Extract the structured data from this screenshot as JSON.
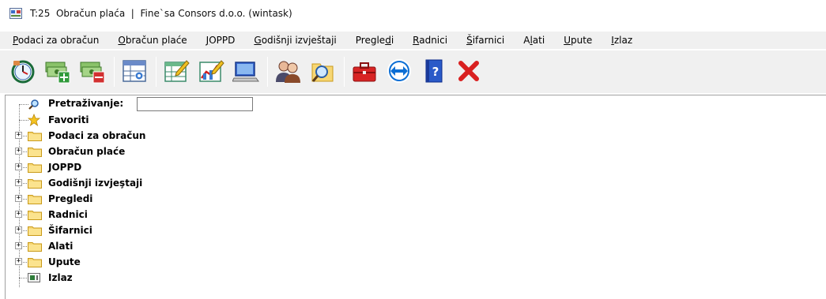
{
  "window": {
    "title": "T:25  Obračun plaća  |  Fine`sa Consors d.o.o. (wintask)"
  },
  "menu": [
    {
      "label": "Podaci za obračun",
      "accel": "P",
      "pre": "",
      "post": "odaci za obračun"
    },
    {
      "label": "Obračun plaće",
      "accel": "O",
      "pre": "",
      "post": "bračun plaće"
    },
    {
      "label": "JOPPD",
      "accel": "J",
      "pre": "",
      "post": "OPPD"
    },
    {
      "label": "Godišnji izvještaji",
      "accel": "G",
      "pre": "",
      "post": "odišnji izvještaji"
    },
    {
      "label": "Pregledi",
      "accel": "d",
      "pre": "Pregle",
      "post": "i"
    },
    {
      "label": "Radnici",
      "accel": "R",
      "pre": "",
      "post": "adnici"
    },
    {
      "label": "Šifarnici",
      "accel": "Š",
      "pre": "",
      "post": "ifarnici"
    },
    {
      "label": "Alati",
      "accel": "l",
      "pre": "A",
      "post": "ati"
    },
    {
      "label": "Upute",
      "accel": "U",
      "pre": "",
      "post": "pute"
    },
    {
      "label": "Izlaz",
      "accel": "I",
      "pre": "",
      "post": "zlaz"
    }
  ],
  "toolbar": [
    {
      "name": "clock-calculation-icon"
    },
    {
      "name": "money-add-icon"
    },
    {
      "name": "money-remove-icon"
    },
    {
      "sep": true
    },
    {
      "name": "table-settings-icon"
    },
    {
      "sep": true
    },
    {
      "name": "table-edit-icon"
    },
    {
      "name": "chart-edit-icon"
    },
    {
      "name": "computer-icon"
    },
    {
      "sep": true
    },
    {
      "name": "users-icon"
    },
    {
      "name": "search-folder-icon"
    },
    {
      "sep": true
    },
    {
      "name": "toolbox-icon"
    },
    {
      "name": "teamviewer-icon"
    },
    {
      "name": "help-book-icon"
    },
    {
      "name": "exit-x-icon"
    }
  ],
  "tree": {
    "search_label": "Pretraživanje:",
    "search_value": "",
    "favorites_label": "Favoriti",
    "folders": [
      "Podaci za obračun",
      "Obračun plaće",
      "JOPPD",
      "Godišnji izvjeştaji",
      "Pregledi",
      "Radnici",
      "Šifarnici",
      "Alati",
      "Upute"
    ],
    "exit_label": "Izlaz"
  },
  "colors": {
    "menu_bg": "#f0f0f0",
    "folder_yellow": "#f7d774",
    "folder_dark": "#d9a824",
    "exit_red": "#d92020"
  }
}
